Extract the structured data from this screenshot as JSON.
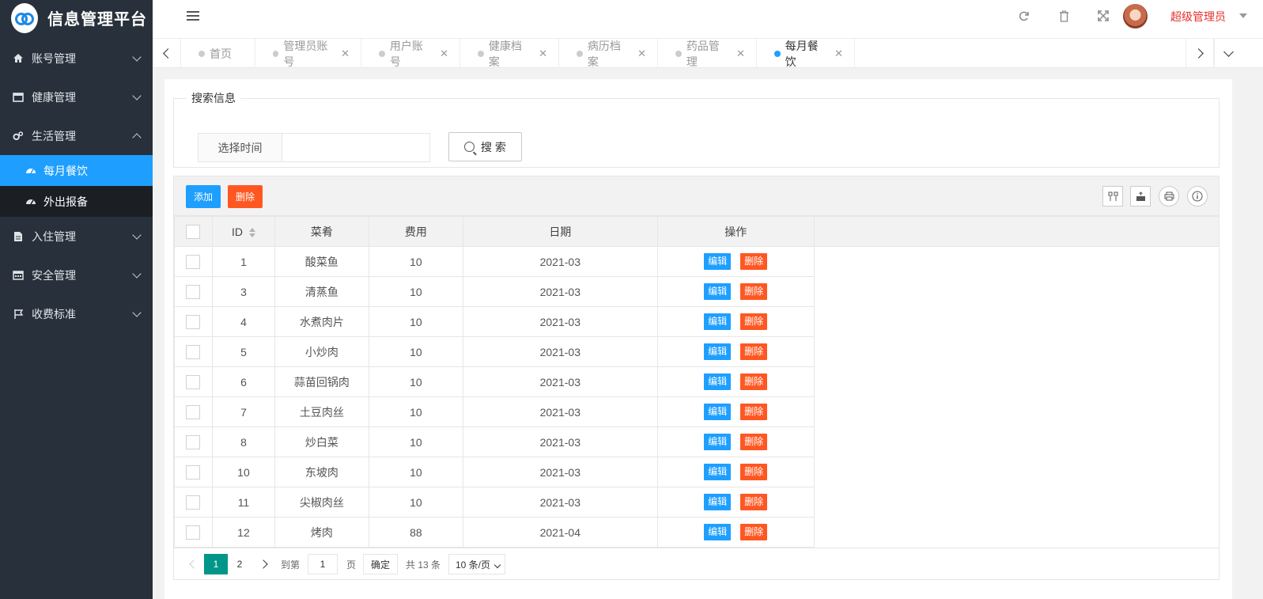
{
  "app": {
    "title": "信息管理平台"
  },
  "sidebar": {
    "items": [
      {
        "label": "账号管理"
      },
      {
        "label": "健康管理"
      },
      {
        "label": "生活管理"
      },
      {
        "label": "入住管理"
      },
      {
        "label": "安全管理"
      },
      {
        "label": "收费标准"
      }
    ],
    "subitems": [
      {
        "label": "每月餐饮"
      },
      {
        "label": "外出报备"
      }
    ]
  },
  "header": {
    "user_name": "超级管理员"
  },
  "tabs": [
    {
      "label": "首页"
    },
    {
      "label": "管理员账号"
    },
    {
      "label": "用户账号"
    },
    {
      "label": "健康档案"
    },
    {
      "label": "病历档案"
    },
    {
      "label": "药品管理"
    },
    {
      "label": "每月餐饮"
    }
  ],
  "search": {
    "legend": "搜索信息",
    "time_label": "选择时间",
    "time_value": "",
    "button_label": "搜 索"
  },
  "toolbar": {
    "add_label": "添加",
    "delete_label": "删除"
  },
  "table": {
    "columns": [
      "ID",
      "菜肴",
      "费用",
      "日期",
      "操作"
    ],
    "edit_label": "编辑",
    "delete_label": "删除",
    "rows": [
      {
        "id": "1",
        "dish": "酸菜鱼",
        "fee": "10",
        "date": "2021-03"
      },
      {
        "id": "3",
        "dish": "清蒸鱼",
        "fee": "10",
        "date": "2021-03"
      },
      {
        "id": "4",
        "dish": "水煮肉片",
        "fee": "10",
        "date": "2021-03"
      },
      {
        "id": "5",
        "dish": "小炒肉",
        "fee": "10",
        "date": "2021-03"
      },
      {
        "id": "6",
        "dish": "蒜苗回锅肉",
        "fee": "10",
        "date": "2021-03"
      },
      {
        "id": "7",
        "dish": "土豆肉丝",
        "fee": "10",
        "date": "2021-03"
      },
      {
        "id": "8",
        "dish": "炒白菜",
        "fee": "10",
        "date": "2021-03"
      },
      {
        "id": "10",
        "dish": "东坡肉",
        "fee": "10",
        "date": "2021-03"
      },
      {
        "id": "11",
        "dish": "尖椒肉丝",
        "fee": "10",
        "date": "2021-03"
      },
      {
        "id": "12",
        "dish": "烤肉",
        "fee": "88",
        "date": "2021-04"
      }
    ]
  },
  "pager": {
    "current_page": "1",
    "page2": "2",
    "goto_label": "到第",
    "goto_value": "1",
    "page_unit": "页",
    "confirm_label": "确定",
    "total_label": "共 13 条",
    "page_size": "10 条/页"
  },
  "colors": {
    "primary": "#1e9fff",
    "danger": "#ff5722",
    "pager_active": "#009688",
    "sidebar_bg": "#28313b"
  }
}
